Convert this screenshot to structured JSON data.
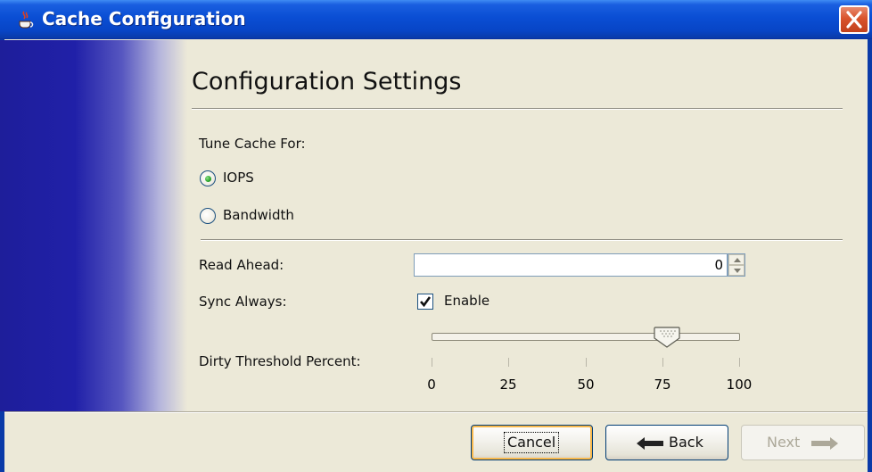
{
  "window": {
    "title": "Cache Configuration"
  },
  "page": {
    "heading": "Configuration Settings"
  },
  "tune_cache": {
    "label": "Tune Cache For:",
    "options": [
      {
        "label": "IOPS",
        "selected": true
      },
      {
        "label": "Bandwidth",
        "selected": false
      }
    ]
  },
  "read_ahead": {
    "label": "Read Ahead:",
    "value": "0"
  },
  "sync_always": {
    "label": "Sync Always:",
    "checkbox_label": "Enable",
    "checked": true
  },
  "dirty_threshold": {
    "label": "Dirty Threshold Percent:",
    "value": 75,
    "ticks": [
      "0",
      "25",
      "50",
      "75",
      "100"
    ]
  },
  "buttons": {
    "cancel": "Cancel",
    "back": "Back",
    "next": "Next"
  },
  "colors": {
    "titlebar": "#0a4ed4",
    "radio_selected": "#2aa52a",
    "cancel_focus": "#f8b84b"
  },
  "icons": {
    "app": "java-coffee-icon",
    "close": "close-icon",
    "back": "arrow-left-icon",
    "next": "arrow-right-icon"
  }
}
